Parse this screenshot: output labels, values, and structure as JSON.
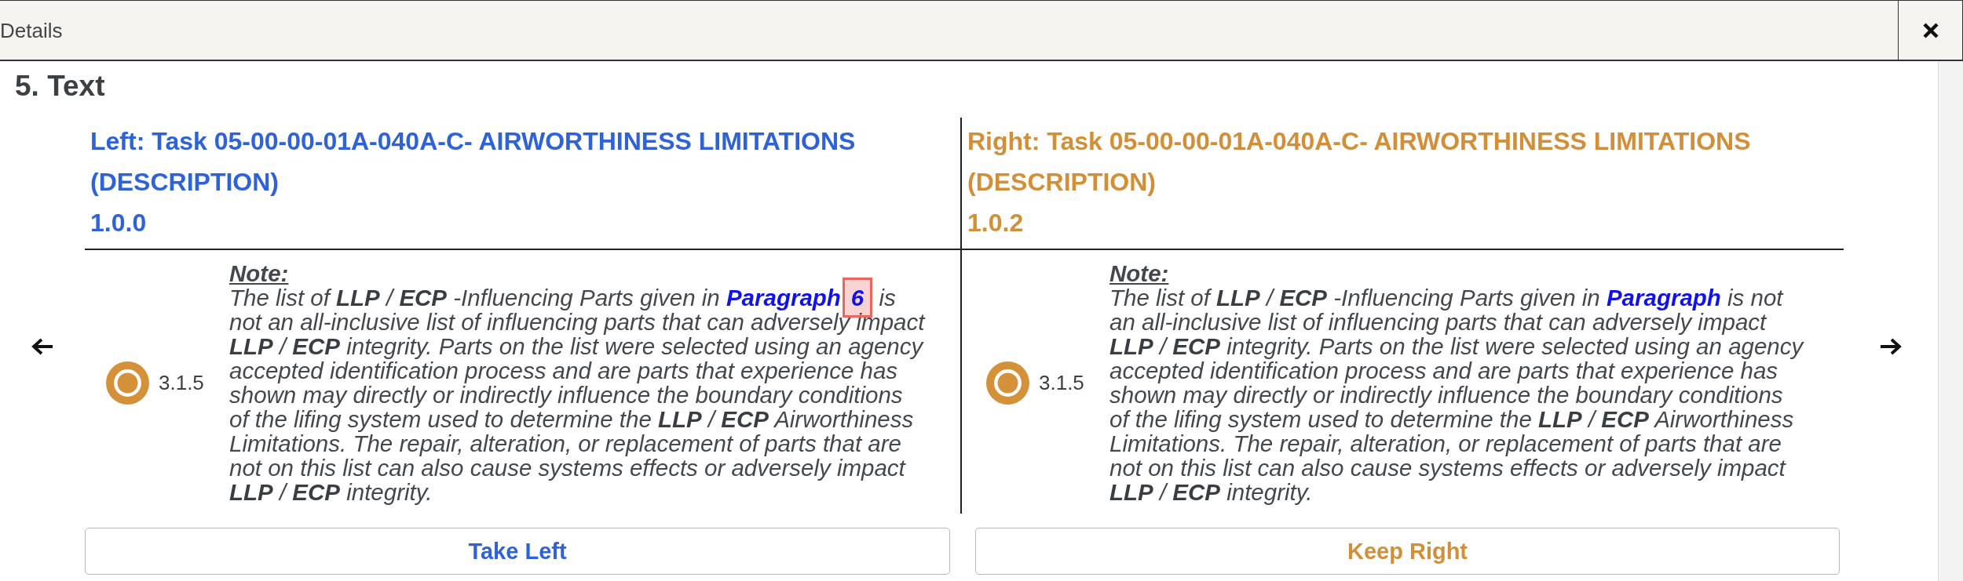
{
  "dialog": {
    "title": "Details"
  },
  "section": {
    "heading": "5. Text"
  },
  "panes": [
    {
      "color": "#2e62d8",
      "title": "Left: Task 05-00-00-01A-040A-C- AIRWORTHINESS LIMITATIONS (DESCRIPTION)",
      "version": "1.0.0",
      "item": {
        "number": "3.1.5",
        "note_label": "Note:",
        "text_before": "The list of **LLP** / **ECP** -Influencing Parts given in ",
        "link": "Paragraph",
        "inserted": "6",
        "text_after": " is not an all-inclusive list of influencing parts that can adversely impact **LLP** / **ECP** integrity. Parts on the list were selected using an agency accepted identification process and are parts that experience has shown may directly or indirectly influence the boundary conditions of the lifing system used to determine the **LLP** / **ECP** Airworthiness Limitations. The repair, alteration, or replacement of parts that are not on this list can also cause systems effects or adversely impact **LLP** / **ECP** integrity."
      },
      "button": "Take Left"
    },
    {
      "color": "#d38f38",
      "title": "Right: Task 05-00-00-01A-040A-C- AIRWORTHINESS LIMITATIONS (DESCRIPTION)",
      "version": "1.0.2",
      "item": {
        "number": "3.1.5",
        "note_label": "Note:",
        "text_before": "The list of **LLP** / **ECP** -Influencing Parts given in ",
        "link": "Paragraph",
        "text_after": " is not an all-inclusive list of influencing parts that can adversely impact **LLP** / **ECP** integrity. Parts on the list were selected using an agency accepted identification process and are parts that experience has shown may directly or indirectly influence the boundary conditions of the lifing system used to determine the **LLP** / **ECP** Airworthiness Limitations. The repair, alteration, or replacement of parts that are not on this list can also cause systems effects or adversely impact **LLP** / **ECP** integrity."
      },
      "button": "Keep Right"
    }
  ]
}
